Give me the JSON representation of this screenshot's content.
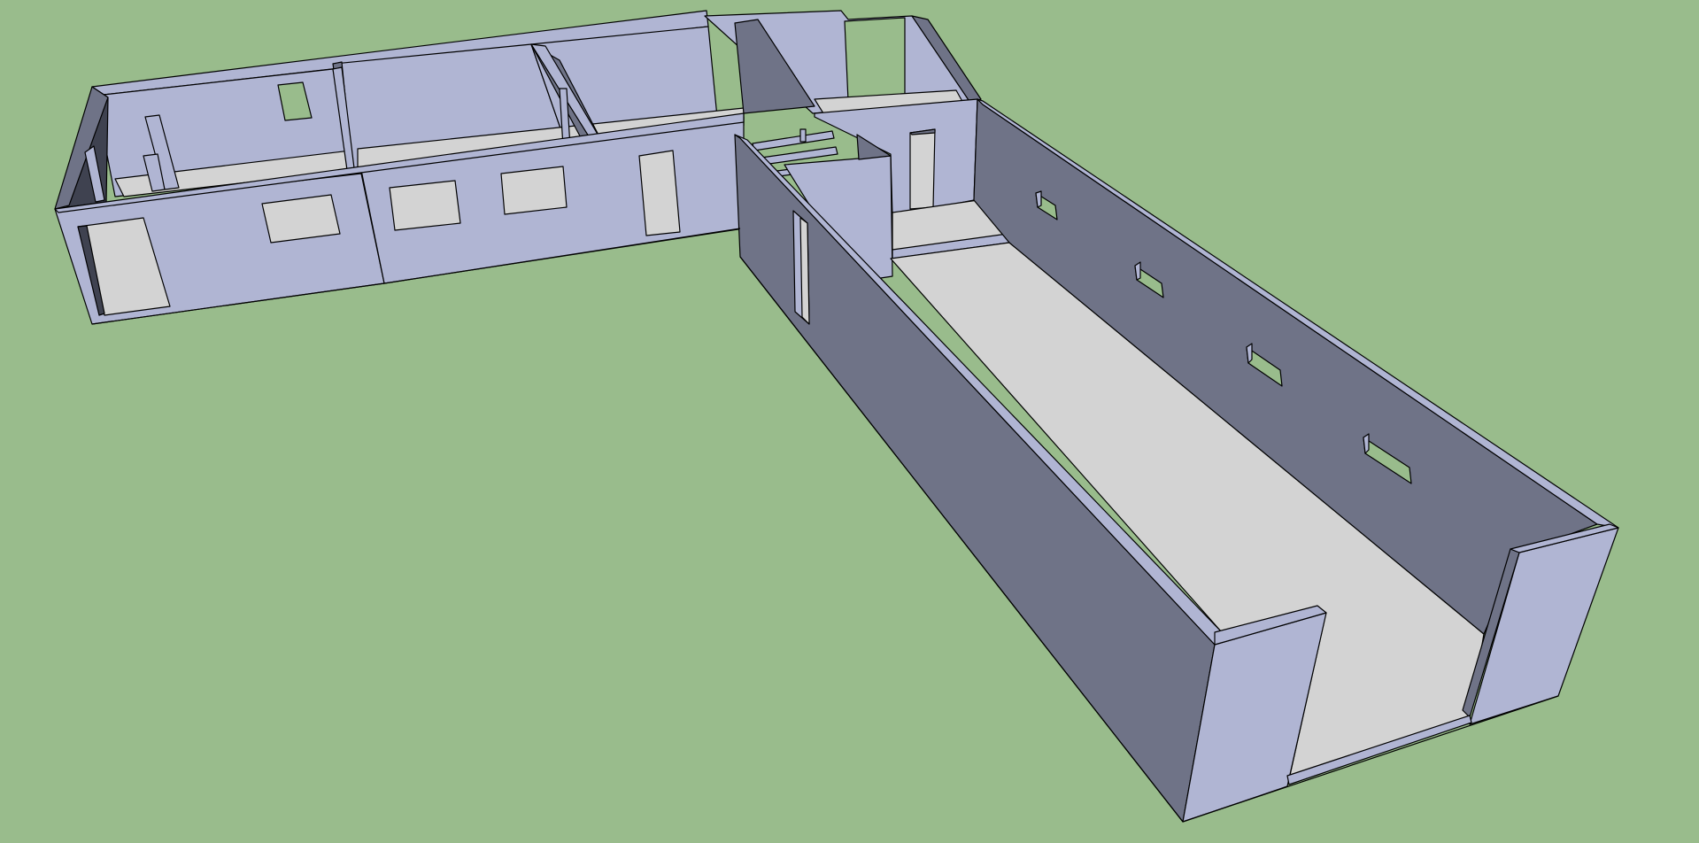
{
  "viewport": {
    "background": "#99bc8c",
    "model": "floor-plan-3d"
  },
  "colors": {
    "wall_light": "#b0b5d3",
    "wall_dark": "#6f7387",
    "wall_darker": "#3f4250",
    "floor": "#d3d3d3",
    "edge": "#000000",
    "ground": "#99bc8c"
  }
}
